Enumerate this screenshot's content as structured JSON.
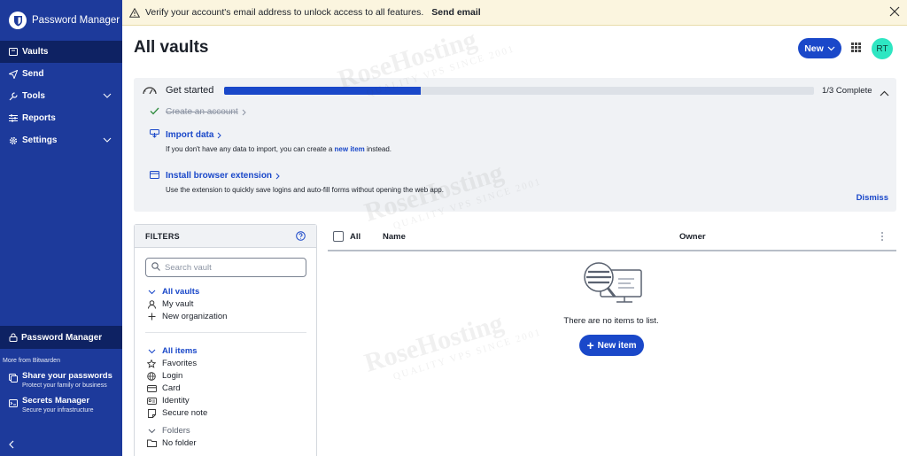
{
  "sidebar": {
    "brand_title": "Password Manager",
    "nav": [
      {
        "label": "Vaults",
        "icon": "vault-icon",
        "active": true
      },
      {
        "label": "Send",
        "icon": "send-icon"
      },
      {
        "label": "Tools",
        "icon": "wrench-icon",
        "expandable": true
      },
      {
        "label": "Reports",
        "icon": "sliders-icon"
      },
      {
        "label": "Settings",
        "icon": "gear-icon",
        "expandable": true
      }
    ],
    "product_switch": "Password Manager",
    "more_from": "More from Bitwarden",
    "promos": [
      {
        "title": "Share your passwords",
        "subtitle": "Protect your family or business",
        "icon": "share-icon"
      },
      {
        "title": "Secrets Manager",
        "subtitle": "Secure your infrastructure",
        "icon": "terminal-icon"
      }
    ]
  },
  "banner": {
    "message": "Verify your account's email address to unlock access to all features.",
    "action": "Send email"
  },
  "header": {
    "title": "All vaults",
    "new_button": "New",
    "avatar_initials": "RT"
  },
  "get_started": {
    "title": "Get started",
    "progress_fraction": 0.333,
    "progress_label": "1/3 Complete",
    "steps": [
      {
        "title": "Create an account",
        "done": true
      },
      {
        "title": "Import data",
        "desc_before": "If you don't have any data to import, you can create a ",
        "desc_link": "new item",
        "desc_after": " instead."
      },
      {
        "title": "Install browser extension",
        "desc": "Use the extension to quickly save logins and auto-fill forms without opening the web app."
      }
    ],
    "dismiss": "Dismiss"
  },
  "filters": {
    "heading": "FILTERS",
    "search_placeholder": "Search vault",
    "vaults": {
      "all": "All vaults",
      "mine": "My vault",
      "new_org": "New organization"
    },
    "types": {
      "all": "All items",
      "favorites": "Favorites",
      "login": "Login",
      "card": "Card",
      "identity": "Identity",
      "note": "Secure note"
    },
    "folders": {
      "heading": "Folders",
      "none": "No folder"
    }
  },
  "table": {
    "col_all": "All",
    "col_name": "Name",
    "col_owner": "Owner",
    "empty_message": "There are no items to list.",
    "new_item_button": "New item"
  },
  "watermark": {
    "brand": "RoseHosting",
    "tagline": "QUALITY VPS SINCE 2001"
  },
  "colors": {
    "sidebar": "#1d3a9b",
    "sidebar_active": "#0e2263",
    "accent": "#1a48c9",
    "banner": "#fbf5df",
    "avatar": "#2ee6c2"
  }
}
